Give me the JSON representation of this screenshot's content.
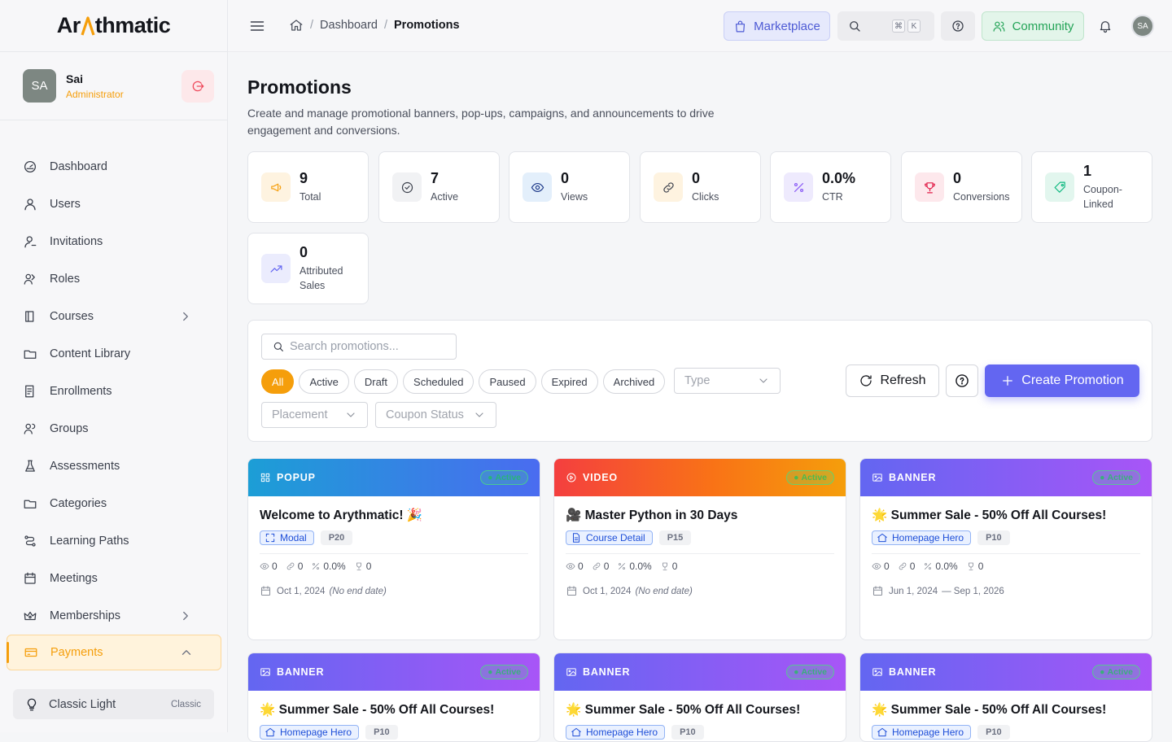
{
  "app": {
    "logo_pre": "Ar",
    "logo_mark": "^",
    "logo_post": "thmatic"
  },
  "user": {
    "initials": "SA",
    "name": "Sai",
    "role": "Administrator"
  },
  "nav": {
    "items": [
      {
        "label": "Dashboard",
        "icon": "dashboard-icon"
      },
      {
        "label": "Users",
        "icon": "user-icon"
      },
      {
        "label": "Invitations",
        "icon": "user-plus-icon"
      },
      {
        "label": "Roles",
        "icon": "roles-icon"
      },
      {
        "label": "Courses",
        "icon": "book-icon",
        "expandable": true
      },
      {
        "label": "Content Library",
        "icon": "folder-icon"
      },
      {
        "label": "Enrollments",
        "icon": "list-icon"
      },
      {
        "label": "Groups",
        "icon": "groups-icon"
      },
      {
        "label": "Assessments",
        "icon": "flask-icon"
      },
      {
        "label": "Categories",
        "icon": "folder-icon"
      },
      {
        "label": "Learning Paths",
        "icon": "route-icon"
      },
      {
        "label": "Meetings",
        "icon": "calendar-icon"
      },
      {
        "label": "Memberships",
        "icon": "crown-icon",
        "expandable": true
      },
      {
        "label": "Payments",
        "icon": "card-icon",
        "active": true
      }
    ]
  },
  "theme": {
    "label": "Classic Light",
    "tag": "Classic"
  },
  "topbar": {
    "breadcrumb": [
      "Dashboard",
      "Promotions"
    ],
    "marketplace_label": "Marketplace",
    "kbd_cmd": "⌘",
    "kbd_key": "K",
    "community_label": "Community",
    "avatar_initials": "SA"
  },
  "page": {
    "title": "Promotions",
    "description": "Create and manage promotional banners, pop-ups, campaigns, and announcements to drive engagement and conversions."
  },
  "stats": [
    {
      "value": "9",
      "label": "Total",
      "icon": "megaphone-icon",
      "color": "#f59e0b",
      "bg": "#fef3e0"
    },
    {
      "value": "7",
      "label": "Active",
      "icon": "check-circle-icon",
      "color": "#3a3f4b",
      "bg": "#f1f2f4"
    },
    {
      "value": "0",
      "label": "Views",
      "icon": "eye-icon",
      "color": "#1e3a8a",
      "bg": "#e3effb"
    },
    {
      "value": "0",
      "label": "Clicks",
      "icon": "link-icon",
      "color": "#3a3f4b",
      "bg": "#fef3e0"
    },
    {
      "value": "0.0%",
      "label": "CTR",
      "icon": "percent-icon",
      "color": "#8b5cf6",
      "bg": "#eeeafd"
    },
    {
      "value": "0",
      "label": "Conversions",
      "icon": "trophy-icon",
      "color": "#e11d48",
      "bg": "#fde8ec"
    },
    {
      "value": "1",
      "label": "Coupon-Linked",
      "icon": "tag-icon",
      "color": "#10b981",
      "bg": "#e2f6ee"
    },
    {
      "value": "0",
      "label": "Attributed Sales",
      "icon": "trend-icon",
      "color": "#6366f1",
      "bg": "#ebecfd"
    }
  ],
  "filters": {
    "search_placeholder": "Search promotions...",
    "status_chips": [
      "All",
      "Active",
      "Draft",
      "Scheduled",
      "Paused",
      "Expired",
      "Archived"
    ],
    "active_chip": "All",
    "type_placeholder": "Type",
    "placement_placeholder": "Placement",
    "coupon_placeholder": "Coupon Status",
    "refresh_label": "Refresh",
    "create_label": "Create Promotion"
  },
  "promotions": [
    {
      "type": "POPUP",
      "status": "Active",
      "title": "Welcome to Arythmatic! 🎉",
      "placement": "Modal",
      "priority": "P20",
      "views": "0",
      "clicks": "0",
      "ctr": "0.0%",
      "conversions": "0",
      "start": "Oct 1, 2024",
      "end": "(No end date)"
    },
    {
      "type": "VIDEO",
      "status": "Active",
      "title": "🎥 Master Python in 30 Days",
      "placement": "Course Detail",
      "priority": "P15",
      "views": "0",
      "clicks": "0",
      "ctr": "0.0%",
      "conversions": "0",
      "start": "Oct 1, 2024",
      "end": "(No end date)"
    },
    {
      "type": "BANNER",
      "status": "Active",
      "title": "🌟 Summer Sale - 50% Off All Courses!",
      "placement": "Homepage Hero",
      "priority": "P10",
      "views": "0",
      "clicks": "0",
      "ctr": "0.0%",
      "conversions": "0",
      "start": "Jun 1, 2024",
      "end": "— Sep 1, 2026"
    },
    {
      "type": "BANNER",
      "status": "Active",
      "title": "🌟 Summer Sale - 50% Off All Courses!",
      "placement": "Homepage Hero",
      "priority": "P10"
    },
    {
      "type": "BANNER",
      "status": "Active",
      "title": "🌟 Summer Sale - 50% Off All Courses!",
      "placement": "Homepage Hero",
      "priority": "P10"
    },
    {
      "type": "BANNER",
      "status": "Active",
      "title": "🌟 Summer Sale - 50% Off All Courses!",
      "placement": "Homepage Hero",
      "priority": "P10"
    }
  ]
}
